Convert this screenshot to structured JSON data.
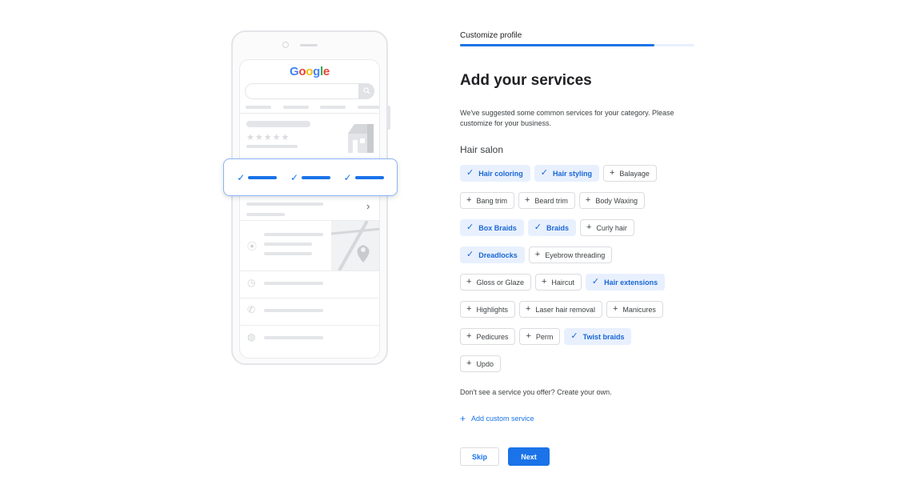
{
  "illustration": {
    "logo_letters": [
      "G",
      "o",
      "o",
      "g",
      "l",
      "e"
    ],
    "stars": "★★★★★",
    "search_icon": "search-icon",
    "check_glyph": "✓",
    "chevron_glyph": "›",
    "icons": {
      "location": "⦿",
      "clock": "◷",
      "phone": "✆",
      "globe": "◍"
    }
  },
  "header": {
    "step_label": "Customize profile",
    "progress_percent": 83
  },
  "main": {
    "title": "Add your services",
    "description": "We've suggested some common services for your category. Please customize for your business.",
    "category": "Hair salon",
    "icons": {
      "selected": "✓",
      "unselected": "+"
    },
    "chip_rows": [
      [
        {
          "label": "Hair coloring",
          "selected": true
        },
        {
          "label": "Hair styling",
          "selected": true
        },
        {
          "label": "Balayage",
          "selected": false
        }
      ],
      [
        {
          "label": "Bang trim",
          "selected": false
        },
        {
          "label": "Beard trim",
          "selected": false
        },
        {
          "label": "Body Waxing",
          "selected": false
        }
      ],
      [
        {
          "label": "Box Braids",
          "selected": true
        },
        {
          "label": "Braids",
          "selected": true
        },
        {
          "label": "Curly hair",
          "selected": false
        }
      ],
      [
        {
          "label": "Dreadlocks",
          "selected": true
        },
        {
          "label": "Eyebrow threading",
          "selected": false
        }
      ],
      [
        {
          "label": "Gloss or Glaze",
          "selected": false
        },
        {
          "label": "Haircut",
          "selected": false
        },
        {
          "label": "Hair extensions",
          "selected": true
        }
      ],
      [
        {
          "label": "Highlights",
          "selected": false
        },
        {
          "label": "Laser hair removal",
          "selected": false
        },
        {
          "label": "Manicures",
          "selected": false
        }
      ],
      [
        {
          "label": "Pedicures",
          "selected": false
        },
        {
          "label": "Perm",
          "selected": false
        },
        {
          "label": "Twist braids",
          "selected": true
        }
      ],
      [
        {
          "label": "Updo",
          "selected": false
        }
      ]
    ],
    "own_service_prompt": "Don't see a service you offer? Create your own.",
    "add_custom_label": "Add custom service",
    "add_custom_icon": "+"
  },
  "footer": {
    "skip_label": "Skip",
    "next_label": "Next"
  },
  "colors": {
    "accent": "#1a73e8",
    "selected_chip_bg": "#e8f0fe",
    "selected_chip_text": "#1967d2",
    "progress_track": "#e8f0fe"
  }
}
